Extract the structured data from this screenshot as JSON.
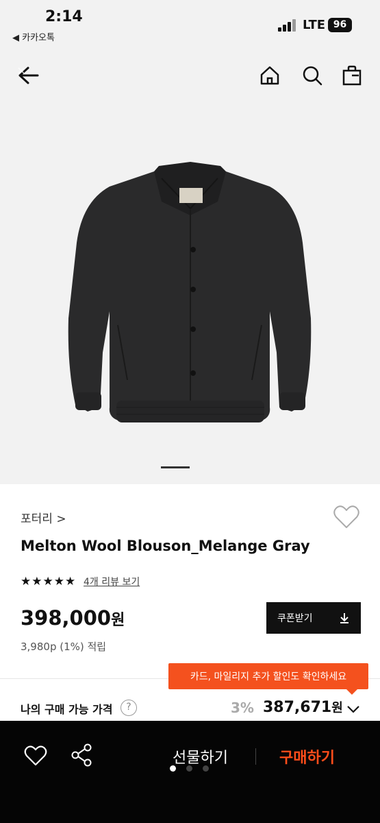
{
  "status_bar": {
    "time": "2:14",
    "back_app": "◀ 카카오톡",
    "network": "LTE",
    "battery": "96"
  },
  "nav": {
    "icons": [
      "back-arrow-icon",
      "home-icon",
      "search-icon",
      "shopping-bag-icon"
    ]
  },
  "product": {
    "brand": "포터리 >",
    "name": "Melton Wool Blouson_Melange Gray",
    "stars": "★★★★★",
    "review_link": "4개 리뷰 보기",
    "price": "398,000",
    "price_unit": "원",
    "points": "3,980p (1%) 적립",
    "coupon_button": "쿠폰받기"
  },
  "promo": {
    "tooltip": "카드, 마일리지 추가 할인도 확인하세요"
  },
  "my_price": {
    "label": "나의 구매 가능 가격",
    "help": "?",
    "discount": "3%",
    "price": "387,671",
    "unit": "원"
  },
  "bottom_bar": {
    "gift": "선물하기",
    "buy": "구매하기"
  },
  "colors": {
    "accent": "#f4511e",
    "buy_text": "#ff4d1a",
    "bottom_bg": "#050505",
    "image_bg": "#f2f2f2"
  }
}
